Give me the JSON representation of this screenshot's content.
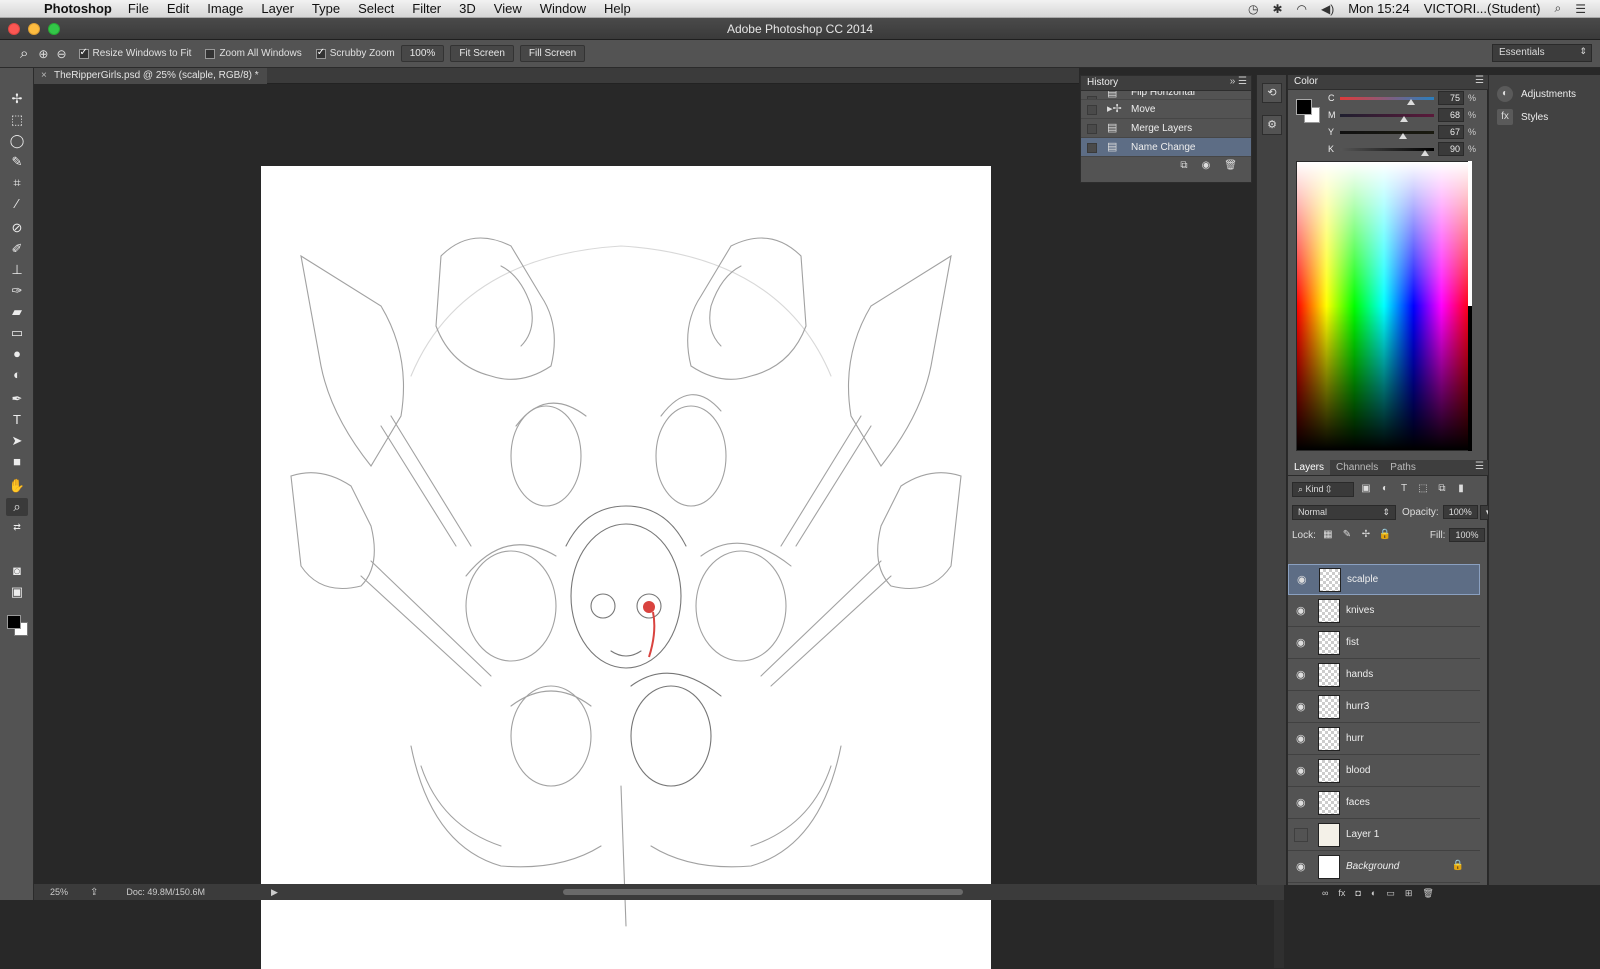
{
  "menubar": {
    "app_name": "Photoshop",
    "items": [
      "File",
      "Edit",
      "Image",
      "Layer",
      "Type",
      "Select",
      "Filter",
      "3D",
      "View",
      "Window",
      "Help"
    ],
    "clock": "Mon 15:24",
    "user": "VICTORI...(Student)"
  },
  "window": {
    "title": "Adobe Photoshop CC 2014"
  },
  "options": {
    "resize_windows": "Resize Windows to Fit",
    "zoom_all": "Zoom All Windows",
    "scrubby": "Scrubby Zoom",
    "zoom_value": "100%",
    "fit_screen": "Fit Screen",
    "fill_screen": "Fill Screen",
    "workspace": "Essentials"
  },
  "document": {
    "tab_title": "TheRipperGirls.psd @ 25% (scalple, RGB/8) *"
  },
  "status": {
    "zoom": "25%",
    "doc_size": "Doc: 49.8M/150.6M"
  },
  "history": {
    "title": "History",
    "items": [
      {
        "label": "Flip Horizontal"
      },
      {
        "label": "Move"
      },
      {
        "label": "Merge Layers"
      },
      {
        "label": "Name Change"
      }
    ]
  },
  "color": {
    "title": "Color",
    "rows": [
      {
        "label": "C",
        "value": "75",
        "pct": "%",
        "level": 0.75,
        "grad": "linear-gradient(to right, #e03a3a, #2a7fbf)"
      },
      {
        "label": "M",
        "value": "68",
        "pct": "%",
        "level": 0.68,
        "grad": "linear-gradient(to right, #1f1f2f, #5a1a3a)"
      },
      {
        "label": "Y",
        "value": "67",
        "pct": "%",
        "level": 0.67,
        "grad": "linear-gradient(to right, #111, #1a1a10)"
      },
      {
        "label": "K",
        "value": "90",
        "pct": "%",
        "level": 0.9,
        "grad": "linear-gradient(to right, #555, #000)"
      }
    ]
  },
  "layers_panel": {
    "tabs": [
      "Layers",
      "Channels",
      "Paths"
    ],
    "kind": "Kind",
    "blend": "Normal",
    "opacity_label": "Opacity:",
    "opacity": "100%",
    "lock_label": "Lock:",
    "fill_label": "Fill:",
    "fill": "100%",
    "layers": [
      {
        "name": "scalple",
        "visible": true,
        "selected": true
      },
      {
        "name": "knives",
        "visible": true
      },
      {
        "name": "fist",
        "visible": true
      },
      {
        "name": "hands",
        "visible": true
      },
      {
        "name": "hurr3",
        "visible": true
      },
      {
        "name": "hurr",
        "visible": true
      },
      {
        "name": "blood",
        "visible": true
      },
      {
        "name": "faces",
        "visible": true
      },
      {
        "name": "Layer 1",
        "visible": false
      },
      {
        "name": "Background",
        "visible": true,
        "locked": true
      }
    ]
  },
  "right_dock": {
    "adjustments": "Adjustments",
    "styles": "Styles"
  }
}
